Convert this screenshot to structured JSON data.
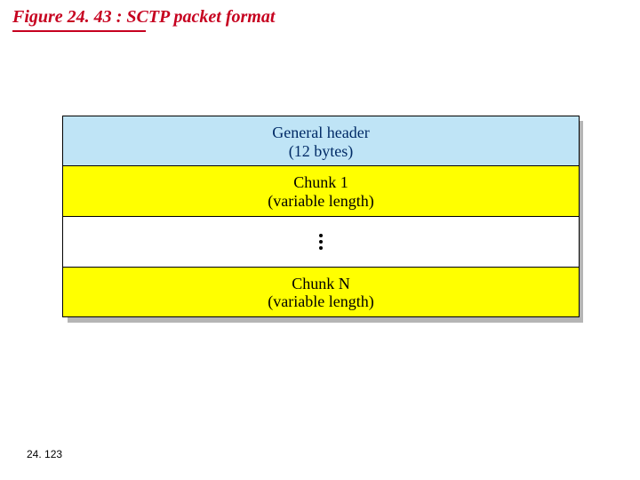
{
  "figure": {
    "label": "Figure 24. 43",
    "separator": "  :  ",
    "title": "SCTP packet format"
  },
  "rows": {
    "header": {
      "line1": "General header",
      "line2": "(12 bytes)"
    },
    "chunk1": {
      "line1": "Chunk 1",
      "line2": "(variable length)"
    },
    "chunkN": {
      "line1": "Chunk N",
      "line2": "(variable length)"
    }
  },
  "page_number": "24. 123"
}
